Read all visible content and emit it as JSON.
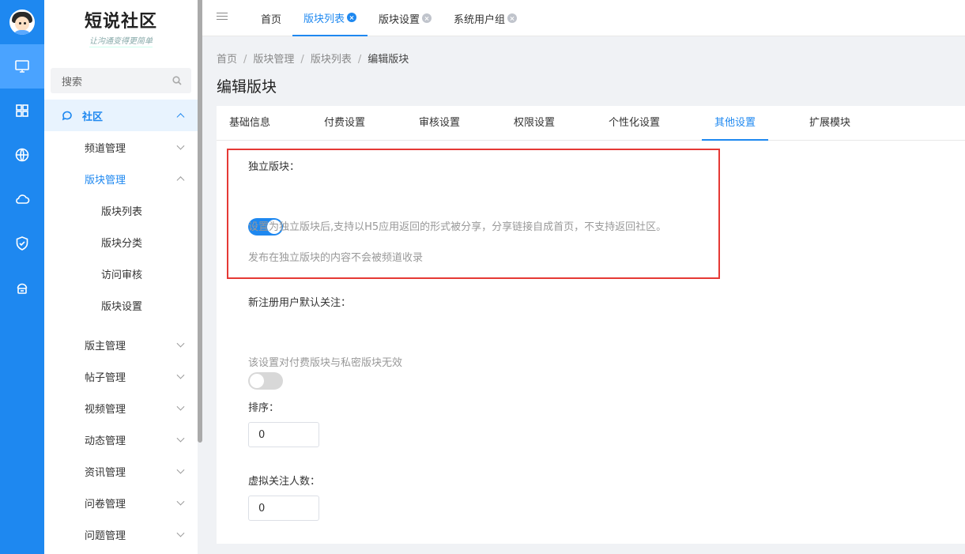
{
  "brand": {
    "name": "短说社区",
    "slogan": "让沟通变得更简单"
  },
  "rail": {
    "items": [
      {
        "icon": "monitor-icon",
        "active": true
      },
      {
        "icon": "grid-icon",
        "active": false
      },
      {
        "icon": "globe-icon",
        "active": false
      },
      {
        "icon": "cloud-icon",
        "active": false
      },
      {
        "icon": "shield-check-icon",
        "active": false
      },
      {
        "icon": "cloud-storage-icon",
        "active": false
      }
    ]
  },
  "sidebar": {
    "search_label": "搜索",
    "group": "社区",
    "items": [
      {
        "label": "频道管理"
      },
      {
        "label": "版块管理"
      },
      {
        "label": "版主管理"
      },
      {
        "label": "帖子管理"
      },
      {
        "label": "视频管理"
      },
      {
        "label": "动态管理"
      },
      {
        "label": "资讯管理"
      },
      {
        "label": "问卷管理"
      },
      {
        "label": "问题管理"
      }
    ],
    "sub_items": [
      {
        "label": "版块列表"
      },
      {
        "label": "版块分类"
      },
      {
        "label": "访问审核"
      },
      {
        "label": "版块设置"
      }
    ]
  },
  "top_tabs": [
    {
      "label": "首页"
    },
    {
      "label": "版块列表"
    },
    {
      "label": "版块设置"
    },
    {
      "label": "系统用户组"
    }
  ],
  "breadcrumb": [
    "首页",
    "版块管理",
    "版块列表",
    "编辑版块"
  ],
  "page_title": "编辑版块",
  "content_tabs": [
    {
      "label": "基础信息"
    },
    {
      "label": "付费设置"
    },
    {
      "label": "审核设置"
    },
    {
      "label": "权限设置"
    },
    {
      "label": "个性化设置"
    },
    {
      "label": "其他设置"
    },
    {
      "label": "扩展模块"
    }
  ],
  "form": {
    "independent": {
      "label": "独立版块：",
      "enabled": true,
      "hint1": "设置为独立版块后,支持以H5应用返回的形式被分享，分享链接自成首页，不支持返回社区。",
      "hint2": "发布在独立版块的内容不会被频道收录"
    },
    "auto_follow": {
      "label": "新注册用户默认关注：",
      "enabled": false,
      "hint": "该设置对付费版块与私密版块无效"
    },
    "sort": {
      "label": "排序：",
      "value": "0"
    },
    "virtual_followers": {
      "label": "虚拟关注人数：",
      "value": "0"
    }
  },
  "colors": {
    "primary": "#1e88f0",
    "highlight": "#e53935"
  }
}
